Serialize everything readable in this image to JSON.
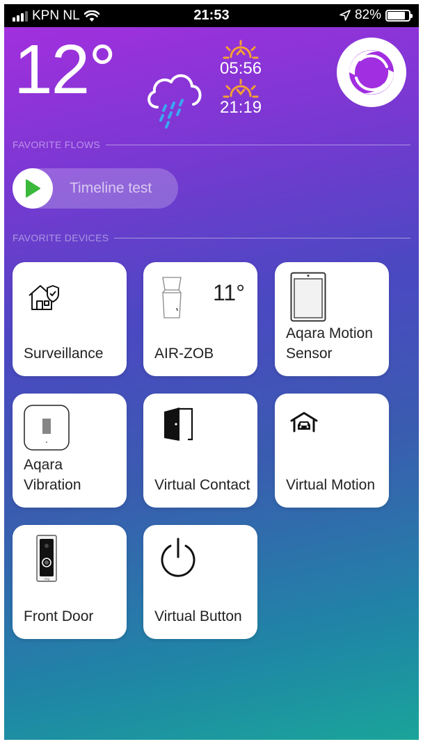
{
  "status_bar": {
    "carrier": "KPN NL",
    "time": "21:53",
    "battery": "82%",
    "battery_level": 0.82
  },
  "weather": {
    "temperature": "12°",
    "condition_icon": "rain-cloud-icon",
    "sunrise": "05:56",
    "sunset": "21:19"
  },
  "favorite_flows": {
    "header": "FAVORITE FLOWS",
    "flows": [
      {
        "label": "Timeline test"
      }
    ]
  },
  "favorite_devices": {
    "header": "FAVORITE DEVICES",
    "devices": [
      {
        "label": "Surveillance",
        "icon": "house-shield-icon"
      },
      {
        "label": "AIR-ZOB",
        "value": "11°",
        "icon": "air-sensor-icon"
      },
      {
        "label": "Aqara Motion Sensor",
        "icon": "motion-sensor-icon"
      },
      {
        "label": "Aqara Vibration",
        "icon": "vibration-sensor-icon"
      },
      {
        "label": "Virtual Contact",
        "icon": "door-contact-icon"
      },
      {
        "label": "Virtual Motion",
        "icon": "garage-car-icon"
      },
      {
        "label": "Front Door",
        "icon": "doorbell-icon"
      },
      {
        "label": "Virtual Button",
        "icon": "power-icon"
      }
    ]
  },
  "colors": {
    "sun_accent": "#f5a033",
    "rain_accent": "#3aa8f0",
    "play_green": "#3cb93c"
  }
}
